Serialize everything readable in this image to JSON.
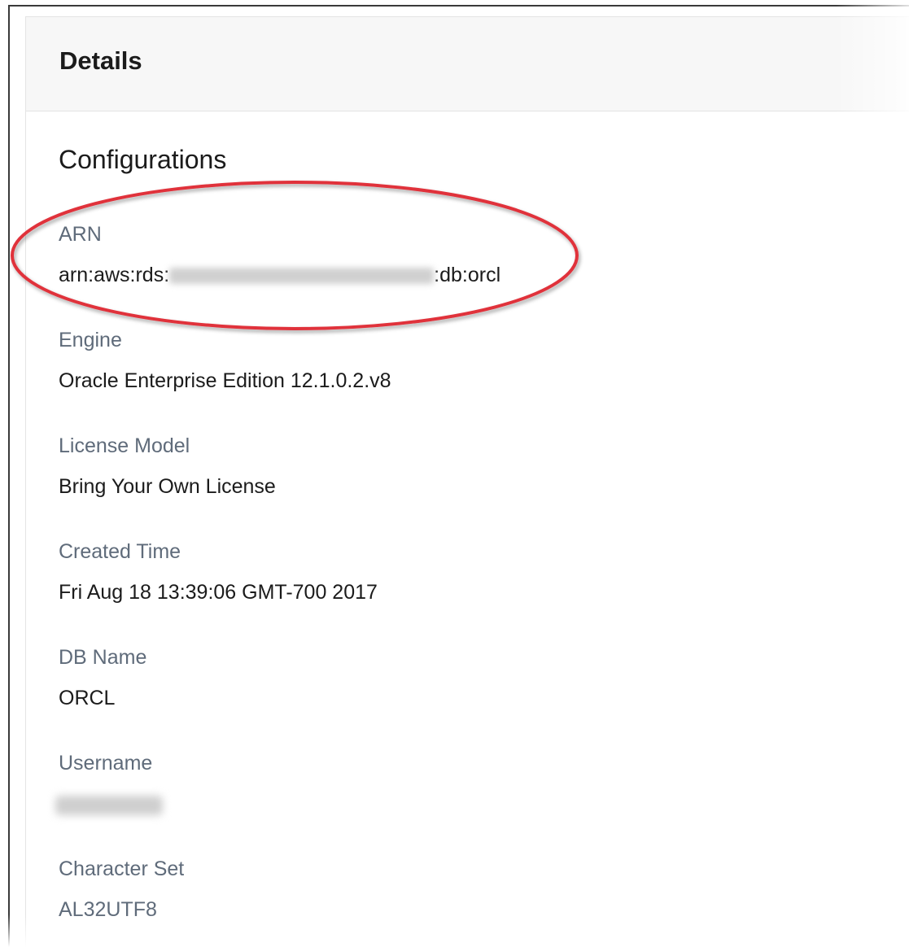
{
  "panel": {
    "title": "Details"
  },
  "configurations": {
    "section_title": "Configurations",
    "arn": {
      "label": "ARN",
      "prefix": "arn:aws:rds:",
      "suffix": ":db:orcl"
    },
    "engine": {
      "label": "Engine",
      "value": "Oracle Enterprise Edition 12.1.0.2.v8"
    },
    "license_model": {
      "label": "License Model",
      "value": "Bring Your Own License"
    },
    "created_time": {
      "label": "Created Time",
      "value": "Fri Aug 18 13:39:06 GMT-700 2017"
    },
    "db_name": {
      "label": "DB Name",
      "value": "ORCL"
    },
    "username": {
      "label": "Username"
    },
    "character_set": {
      "label": "Character Set",
      "value": "AL32UTF8"
    }
  },
  "colors": {
    "highlight": "#e0303a",
    "label": "#5f6b7a",
    "value": "#1b1b1b",
    "header_bg": "#f7f7f7"
  }
}
